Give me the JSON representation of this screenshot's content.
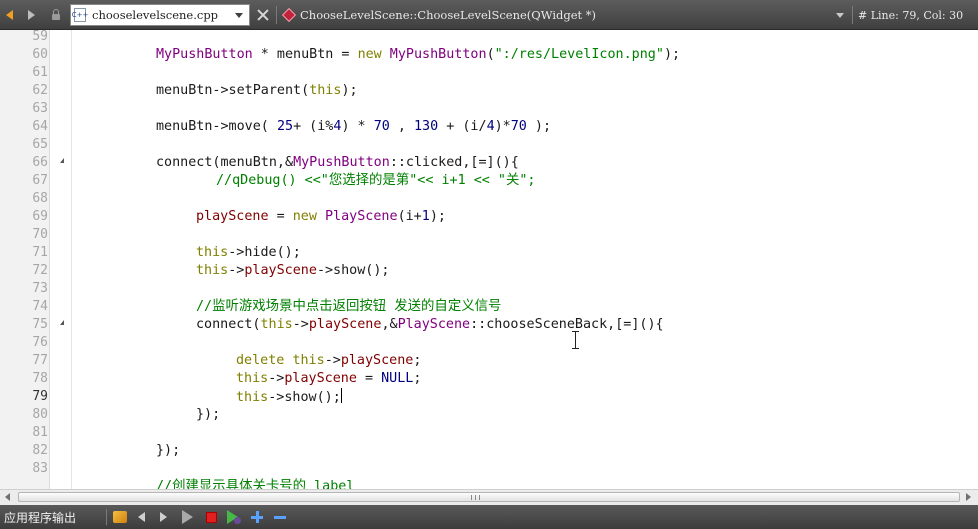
{
  "toolbar": {
    "file_name": "chooselevelscene.cpp",
    "file_icon_label": "C++",
    "function_signature": "ChooseLevelScene::ChooseLevelScene(QWidget *)",
    "position_indicator": "# Line: 79, Col: 30"
  },
  "editor": {
    "current_line": 79,
    "lines": [
      {
        "n": "59"
      },
      {
        "n": "60"
      },
      {
        "n": "61"
      },
      {
        "n": "62"
      },
      {
        "n": "63"
      },
      {
        "n": "64"
      },
      {
        "n": "65"
      },
      {
        "n": "66"
      },
      {
        "n": "67"
      },
      {
        "n": "68"
      },
      {
        "n": "69"
      },
      {
        "n": "70"
      },
      {
        "n": "71"
      },
      {
        "n": "72"
      },
      {
        "n": "73"
      },
      {
        "n": "74"
      },
      {
        "n": "75"
      },
      {
        "n": "76"
      },
      {
        "n": "77"
      },
      {
        "n": "78"
      },
      {
        "n": "79"
      },
      {
        "n": "80"
      },
      {
        "n": "81"
      },
      {
        "n": "82"
      },
      {
        "n": "83"
      }
    ],
    "code": {
      "l60_type": "MyPushButton",
      "l60_mid": " * menuBtn = ",
      "l60_new": "new",
      "l60_type2": " MyPushButton",
      "l60_open": "(",
      "l60_str": "\":/res/LevelIcon.png\"",
      "l60_close": ");",
      "l62_a": "menuBtn->setParent(",
      "l62_this": "this",
      "l62_b": ");",
      "l64_a": "menuBtn->move( ",
      "l64_n1": "25",
      "l64_b": "+ (i%",
      "l64_n2": "4",
      "l64_c": ") * ",
      "l64_n3": "70",
      "l64_d": " , ",
      "l64_n4": "130",
      "l64_e": " + (i/",
      "l64_n5": "4",
      "l64_f": ")*",
      "l64_n6": "70",
      "l64_g": " );",
      "l66_a": "connect(menuBtn,&",
      "l66_type": "MyPushButton",
      "l66_b": "::clicked,[=](){",
      "l67_cmt": "//qDebug() <<\"您选择的是第\"<< i+1 << \"关\";",
      "l69_fld": "playScene",
      "l69_a": " = ",
      "l69_new": "new",
      "l69_type": " PlayScene",
      "l69_b": "(i+",
      "l69_n": "1",
      "l69_c": ");",
      "l71_this": "this",
      "l71_a": "->hide();",
      "l72_this": "this",
      "l72_a": "->",
      "l72_fld": "playScene",
      "l72_b": "->show();",
      "l74_cmt": "//监听游戏场景中点击返回按钮 发送的自定义信号",
      "l75_a": "connect(",
      "l75_this": "this",
      "l75_b": "->",
      "l75_fld": "playScene",
      "l75_c": ",&",
      "l75_type": "PlayScene",
      "l75_d": "::chooseSceneBack,[=](){",
      "l77_kw": "delete",
      "l77_sp": " ",
      "l77_this": "this",
      "l77_a": "->",
      "l77_fld": "playScene",
      "l77_b": ";",
      "l78_this": "this",
      "l78_a": "->",
      "l78_fld": "playScene",
      "l78_b": " = ",
      "l78_null": "NULL",
      "l78_c": ";",
      "l79_this": "this",
      "l79_a": "->show();",
      "l80_a": "});",
      "l82_a": "});",
      "l84_cmt": "//创建显示具体关卡号的 label"
    }
  },
  "bottom_panel": {
    "label": "应用程序输出"
  },
  "colors": {
    "keyword": "#808000",
    "type": "#800080",
    "member": "#800000",
    "string_comment": "#008000",
    "number": "#000080"
  },
  "icons": [
    "back-arrow-icon",
    "forward-arrow-icon",
    "lock-icon",
    "cpp-file-icon",
    "dropdown-icon",
    "close-icon",
    "function-icon",
    "build-icon",
    "previous-icon",
    "next-icon",
    "run-icon",
    "stop-icon",
    "debug-icon",
    "zoom-in-icon",
    "zoom-out-icon"
  ]
}
